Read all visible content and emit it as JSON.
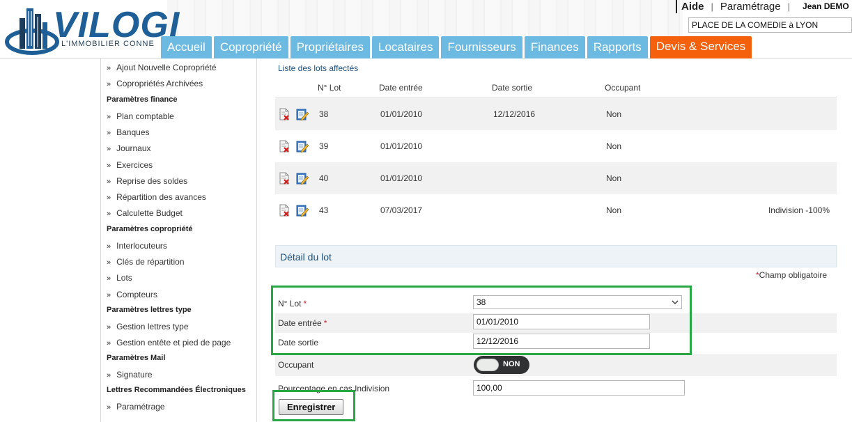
{
  "header": {
    "logo_text": "VILOGI",
    "logo_tagline": "L'IMMOBILIER CONNE",
    "top_links": [
      "Aide",
      "Paramétrage"
    ],
    "user_name": "Jean DEMO",
    "site_selector_value": "PLACE DE LA COMEDIE à LYON",
    "nav_tabs": [
      "Accueil",
      "Copropriété",
      "Propriétaires",
      "Locataires",
      "Fournisseurs",
      "Finances",
      "Rapports",
      "Devis & Services"
    ],
    "active_tab": "Devis & Services",
    "colors": {
      "tab": "#6cb9e2",
      "active_tab": "#f4600c",
      "logo": "#1d5f96"
    }
  },
  "sidebar": {
    "items": [
      {
        "type": "link",
        "label": "Ajout Nouvelle Copropriété"
      },
      {
        "type": "link",
        "label": "Copropriétés Archivées"
      },
      {
        "type": "heading",
        "label": "Paramètres finance"
      },
      {
        "type": "link",
        "label": "Plan comptable"
      },
      {
        "type": "link",
        "label": "Banques"
      },
      {
        "type": "link",
        "label": "Journaux"
      },
      {
        "type": "link",
        "label": "Exercices"
      },
      {
        "type": "link",
        "label": "Reprise des soldes"
      },
      {
        "type": "link",
        "label": "Répartition des avances"
      },
      {
        "type": "link",
        "label": "Calculette Budget"
      },
      {
        "type": "heading",
        "label": "Paramètres copropriété"
      },
      {
        "type": "link",
        "label": "Interlocuteurs"
      },
      {
        "type": "link",
        "label": "Clés de répartition"
      },
      {
        "type": "link",
        "label": "Lots"
      },
      {
        "type": "link",
        "label": "Compteurs"
      },
      {
        "type": "heading",
        "label": "Paramètres lettres type"
      },
      {
        "type": "link",
        "label": "Gestion lettres type"
      },
      {
        "type": "link",
        "label": "Gestion entête et pied de page"
      },
      {
        "type": "heading",
        "label": "Paramètres Mail"
      },
      {
        "type": "link",
        "label": "Signature"
      },
      {
        "type": "heading",
        "label": "Lettres Recommandées Électroniques"
      },
      {
        "type": "link",
        "label": "Paramétrage"
      }
    ],
    "bullet": "»"
  },
  "lots": {
    "title": "Liste des lots affectés",
    "columns": [
      "N° Lot",
      "Date entrée",
      "Date sortie",
      "Occupant"
    ],
    "rows": [
      {
        "lot": "38",
        "date_entree": "01/01/2010",
        "date_sortie": "12/12/2016",
        "occupant": "Non",
        "extra": ""
      },
      {
        "lot": "39",
        "date_entree": "01/01/2010",
        "date_sortie": "",
        "occupant": "Non",
        "extra": ""
      },
      {
        "lot": "40",
        "date_entree": "01/01/2010",
        "date_sortie": "",
        "occupant": "Non",
        "extra": ""
      },
      {
        "lot": "43",
        "date_entree": "07/03/2017",
        "date_sortie": "",
        "occupant": "Non",
        "extra": "Indivision -100%"
      }
    ],
    "row_icons": [
      "delete-doc-icon",
      "edit-doc-icon"
    ]
  },
  "detail": {
    "title": "Détail du lot",
    "required_note": "Champ obligatoire",
    "required_mark": "*",
    "fields": {
      "lot_label": "N° Lot",
      "lot_value": "38",
      "date_entree_label": "Date entrée",
      "date_entree_value": "01/01/2010",
      "date_sortie_label": "Date sortie",
      "date_sortie_value": "12/12/2016",
      "occupant_label": "Occupant",
      "occupant_state": "NON",
      "pourcentage_label": "Pourcentage en cas Indivision",
      "pourcentage_value": "100,00"
    },
    "save_label": "Enregistrer"
  }
}
